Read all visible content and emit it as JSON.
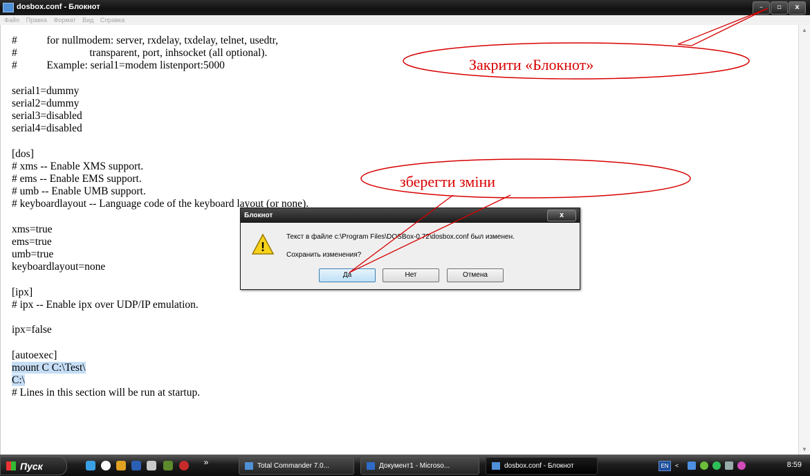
{
  "window": {
    "title": "dosbox.conf - Блокнот",
    "min_glyph": "–",
    "max_glyph": "▫",
    "close_glyph": "x"
  },
  "menu": [
    "Файл",
    "Правка",
    "Формат",
    "Вид",
    "Справка"
  ],
  "editor": {
    "lines": [
      "#           for nullmodem: server, rxdelay, txdelay, telnet, usedtr,",
      "#                           transparent, port, inhsocket (all optional).",
      "#           Example: serial1=modem listenport:5000",
      "",
      "serial1=dummy",
      "serial2=dummy",
      "serial3=disabled",
      "serial4=disabled",
      "",
      "[dos]",
      "# xms -- Enable XMS support.",
      "# ems -- Enable EMS support.",
      "# umb -- Enable UMB support.",
      "# keyboardlayout -- Language code of the keyboard layout (or none).",
      "",
      "xms=true",
      "ems=true",
      "umb=true",
      "keyboardlayout=none",
      "",
      "[ipx]",
      "# ipx -- Enable ipx over UDP/IP emulation.",
      "",
      "ipx=false",
      "",
      "[autoexec]",
      "mount C C:\\Test\\",
      "C:\\",
      "# Lines in this section will be run at startup."
    ],
    "selected_lines": [
      26,
      27
    ]
  },
  "dialog": {
    "title": "Блокнот",
    "close_glyph": "x",
    "message": "Текст в файле c:\\Program Files\\DOSBox-0.72\\dosbox.conf был изменен.",
    "question": "Сохранить изменения?",
    "buttons": {
      "yes": "Да",
      "no": "Нет",
      "cancel": "Отмена"
    },
    "warning_glyph": "!"
  },
  "annotations": {
    "close_callout": "Закрити «Блокнот»",
    "save_callout": "зберегти зміни",
    "color": "#d80000"
  },
  "taskbar": {
    "start_label": "Пуск",
    "overflow": "»",
    "tasks": [
      "Total Commander 7.0...",
      "Документ1 - Microso...",
      "dosbox.conf - Блокнот"
    ],
    "language": "EN",
    "tray_chevron": "<",
    "clock": "8:59"
  }
}
